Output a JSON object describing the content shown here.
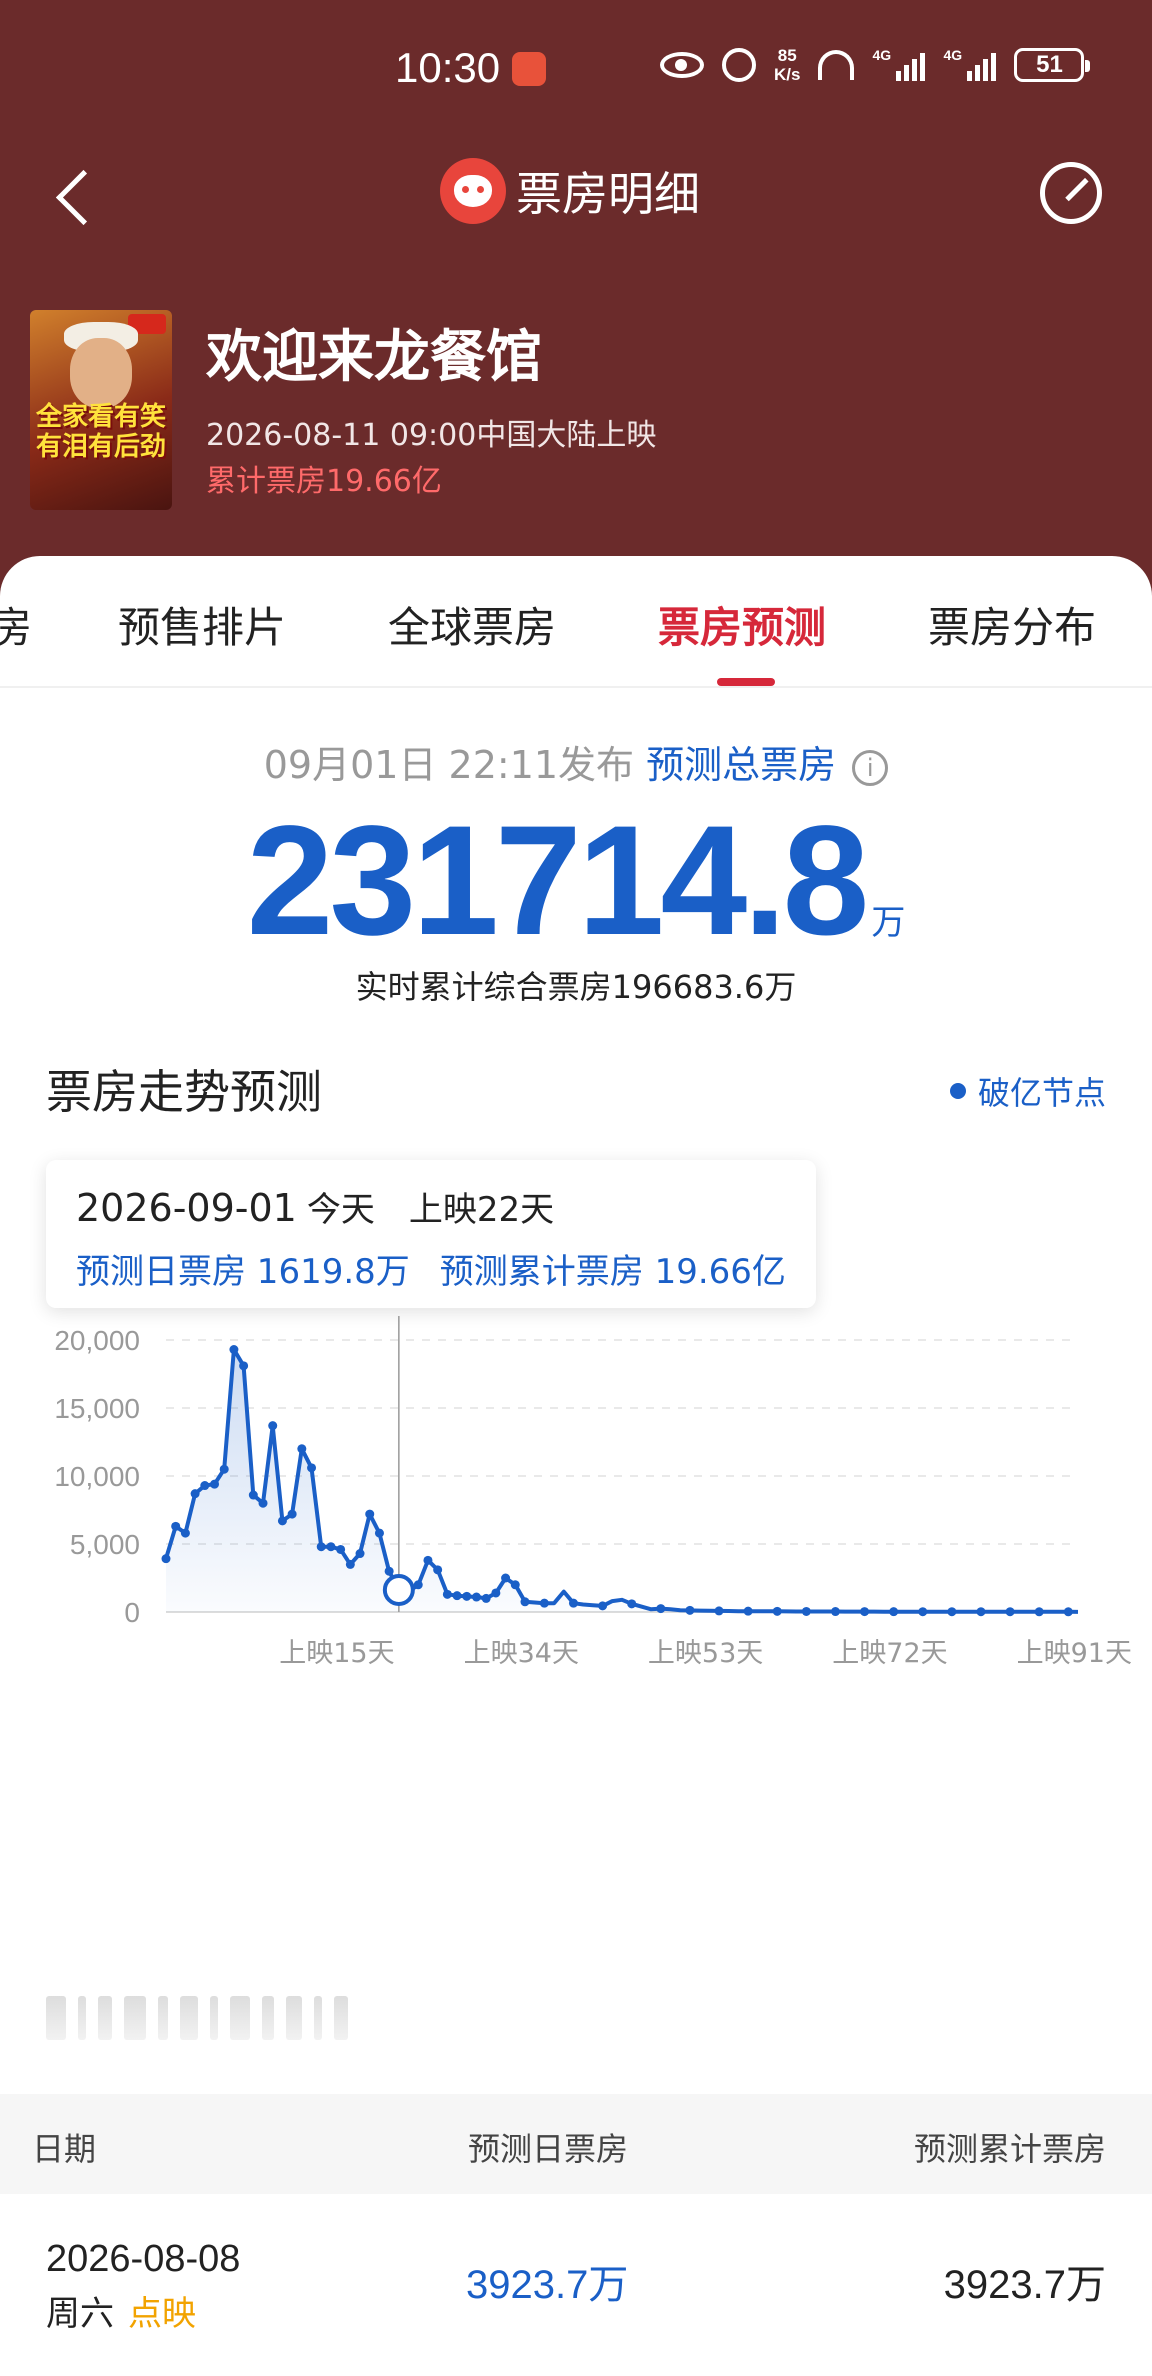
{
  "status_bar": {
    "time": "10:30",
    "net_speed_value": "85",
    "net_speed_unit": "K/s",
    "signal_1": "4G",
    "signal_2": "4G",
    "battery": "51"
  },
  "nav": {
    "title": "票房明细"
  },
  "movie": {
    "title": "欢迎来龙餐馆",
    "release": "2026-08-11 09:00中国大陆上映",
    "cumulative": "累计票房19.66亿",
    "poster_text": "全家看有笑有泪有后劲"
  },
  "tabs": [
    {
      "label": "房"
    },
    {
      "label": "预售排片"
    },
    {
      "label": "全球票房"
    },
    {
      "label": "票房预测",
      "active": true
    },
    {
      "label": "票房分布"
    }
  ],
  "forecast": {
    "published": "09月01日 22:11发布",
    "label": "预测总票房",
    "info_icon": "i",
    "total": "231714.8",
    "unit": "万",
    "realtime": "实时累计综合票房196683.6万"
  },
  "trend": {
    "title": "票房走势预测",
    "legend": "破亿节点",
    "tooltip": {
      "date": "2026-09-01",
      "day": "今天",
      "screening": "上映22天",
      "daily": "预测日票房 1619.8万",
      "cumulative": "预测累计票房 19.66亿"
    }
  },
  "chart_data": {
    "type": "line",
    "ylim": [
      0,
      20000
    ],
    "yticks": [
      "20,000",
      "15,000",
      "10,000",
      "5,000",
      "0"
    ],
    "ytick_values": [
      20000,
      15000,
      10000,
      5000,
      0
    ],
    "xticks": [
      "上映15天",
      "上映34天",
      "上映53天",
      "上映72天",
      "上映91天"
    ],
    "xtick_values": [
      15,
      34,
      53,
      72,
      91
    ],
    "xlim": [
      -2,
      92
    ],
    "highlight_x": 22,
    "x": [
      -2,
      -1,
      0,
      1,
      2,
      3,
      4,
      5,
      6,
      7,
      8,
      9,
      10,
      11,
      12,
      13,
      14,
      15,
      16,
      17,
      18,
      19,
      20,
      21,
      22,
      23,
      24,
      25,
      26,
      27,
      28,
      29,
      30,
      31,
      32,
      33,
      34,
      35,
      36,
      37,
      38,
      39,
      40,
      41,
      42,
      43,
      44,
      45,
      46,
      47,
      48,
      49,
      50,
      51,
      52,
      53,
      54,
      55,
      56,
      57,
      58,
      59,
      60,
      61,
      62,
      63,
      64,
      65,
      66,
      67,
      68,
      69,
      70,
      71,
      72,
      73,
      74,
      75,
      76,
      77,
      78,
      79,
      80,
      81,
      82,
      83,
      84,
      85,
      86,
      87,
      88,
      89,
      90,
      91,
      92
    ],
    "values": [
      3923.7,
      6300,
      5800,
      8700,
      9300,
      9400,
      10500,
      19300,
      18100,
      8600,
      8000,
      13700,
      6700,
      7200,
      12000,
      10600,
      4800,
      4800,
      4600,
      3500,
      4300,
      7200,
      5800,
      3000,
      1619.8,
      1500,
      2000,
      3800,
      3100,
      1300,
      1200,
      1150,
      1100,
      1000,
      1400,
      2500,
      2000,
      750,
      700,
      650,
      650,
      1500,
      650,
      550,
      500,
      450,
      800,
      900,
      600,
      400,
      200,
      250,
      200,
      130,
      120,
      100,
      90,
      80,
      70,
      60,
      60,
      50,
      50,
      50,
      45,
      40,
      40,
      40,
      35,
      35,
      30,
      30,
      30,
      30,
      25,
      25,
      25,
      25,
      20,
      20,
      20,
      20,
      20,
      20,
      20,
      20,
      20,
      20,
      15,
      15,
      15,
      15,
      15,
      15,
      10
    ]
  },
  "table": {
    "headers": [
      "日期",
      "预测日票房",
      "预测累计票房"
    ],
    "rows": [
      {
        "date": "2026-08-08",
        "weekday": "周六",
        "tag": "点映",
        "daily": "3923.7万",
        "cumulative": "3923.7万"
      }
    ]
  },
  "colors": {
    "header_bg": "#6b2b2b",
    "accent_red": "#d6283a",
    "accent_blue": "#1a5fc7",
    "tag_orange": "#f2a300"
  }
}
